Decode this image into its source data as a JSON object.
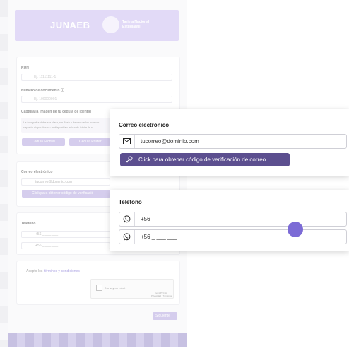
{
  "banner": {
    "logo": "JUNAEB",
    "subtitle_line1": "Tarjeta Nacional",
    "subtitle_line2": "Estudiantil"
  },
  "background_form": {
    "run_label": "RUN",
    "run_placeholder": "Ej. 11111111-1",
    "doc_label": "Número de documento ⓘ",
    "doc_placeholder": "Ej. 100000001",
    "capture_label": "Captura la imagen de tu cédula de identid",
    "capture_hint1": "La fotografía debe ser clara, sin flash y dentro de los marcos",
    "capture_hint2": "espacio disponible en tu dispositivo antes de iniciar la c",
    "front_button": "Cédula Frontal",
    "back_button": "Cédula Poster",
    "email_label": "Correo electrónico",
    "email_value": "tucorreo@dominio.com",
    "verify_button": "Click para obtener código de verificació",
    "phone_label": "Telefono",
    "phone_value1": "+56 _ ___ ___",
    "phone_value2": "+56 _ ___ ___",
    "terms_prefix": "Acepto los",
    "terms_link": "términos y condiciones",
    "captcha_label": "No soy un robot",
    "captcha_brand": "reCAPTCHA",
    "captcha_links": "Privacidad - Términos",
    "next_button": "Siguiente"
  },
  "email_panel": {
    "label": "Correo electrónico",
    "value": "tucorreo@dominio.com",
    "button": "Click para obtener código de verificación de correo"
  },
  "phone_panel": {
    "label": "Telefono",
    "value1": "+56 _ ___ ___",
    "value2": "+56 _ ___ ___"
  },
  "icons": {
    "email": "envelope-icon",
    "key": "key-icon",
    "whatsapp": "whatsapp-icon"
  },
  "colors": {
    "banner": "#cbbdf1",
    "button": "#5c4f8f",
    "cursor": "#7c6bd6"
  }
}
